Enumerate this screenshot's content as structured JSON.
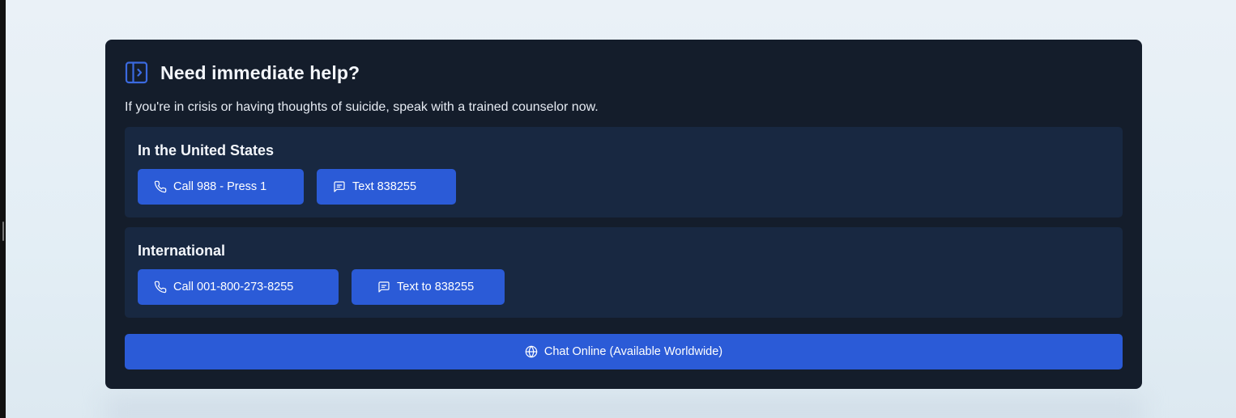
{
  "header": {
    "title": "Need immediate help?",
    "icon": "sidebar-panel-icon"
  },
  "description": "If you're in crisis or having thoughts of suicide, speak with a trained counselor now.",
  "regions": [
    {
      "title": "In the United States",
      "buttons": [
        {
          "label": "Call 988 - Press 1",
          "icon": "phone-icon"
        },
        {
          "label": "Text 838255",
          "icon": "message-icon"
        }
      ]
    },
    {
      "title": "International",
      "buttons": [
        {
          "label": "Call 001-800-273-8255",
          "icon": "phone-icon"
        },
        {
          "label": "Text to 838255",
          "icon": "message-icon"
        }
      ]
    }
  ],
  "chat": {
    "label": "Chat Online (Available Worldwide)",
    "icon": "globe-icon"
  },
  "colors": {
    "card_background": "#141d2b",
    "region_background": "#182841",
    "button_blue": "#2b5bd7",
    "icon_blue": "#3b6ae0",
    "page_background": "#e3eef5"
  }
}
